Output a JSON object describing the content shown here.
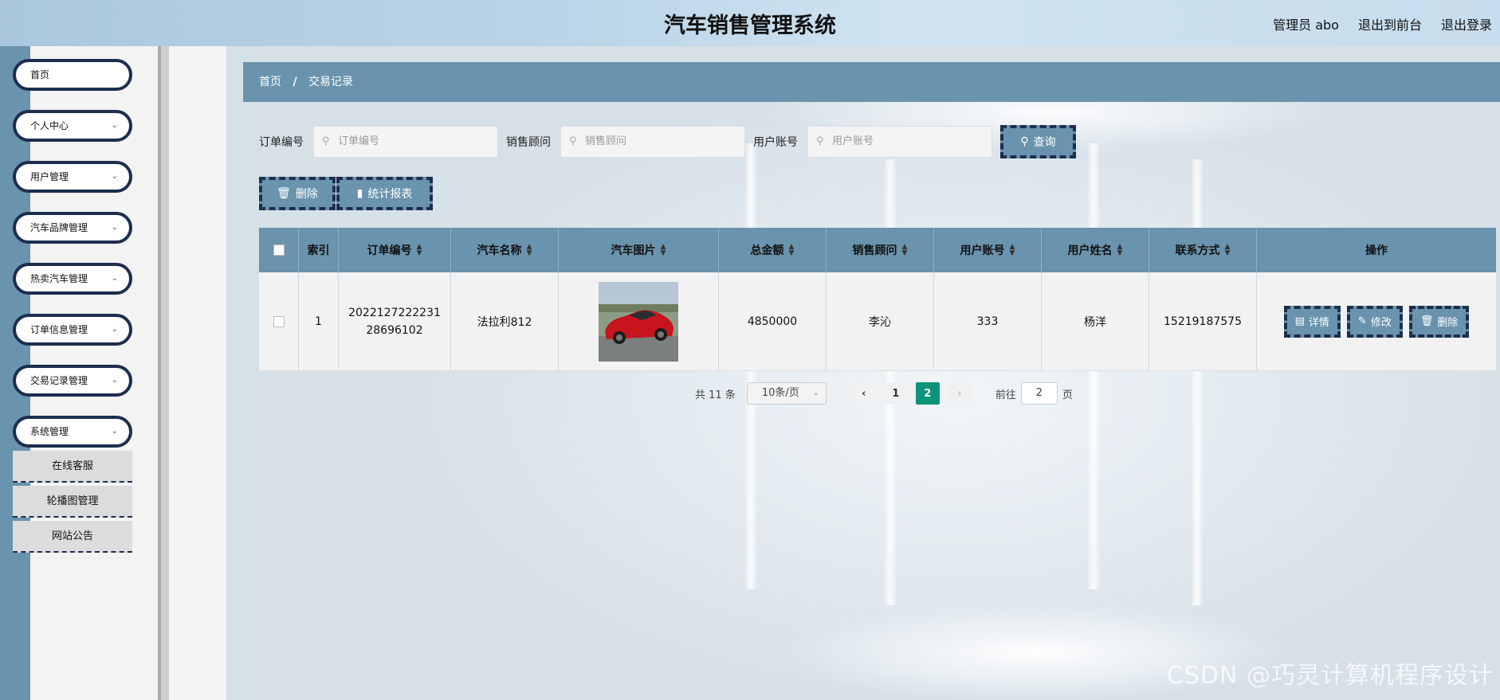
{
  "header": {
    "title": "汽车销售管理系统",
    "admin": "管理员 abo",
    "to_front": "退出到前台",
    "logout": "退出登录"
  },
  "sidebar": {
    "items": [
      {
        "label": "首页",
        "expandable": false
      },
      {
        "label": "个人中心",
        "expandable": true
      },
      {
        "label": "用户管理",
        "expandable": true
      },
      {
        "label": "汽车品牌管理",
        "expandable": true
      },
      {
        "label": "热卖汽车管理",
        "expandable": true
      },
      {
        "label": "订单信息管理",
        "expandable": true
      },
      {
        "label": "交易记录管理",
        "expandable": true
      },
      {
        "label": "系统管理",
        "expandable": true
      }
    ],
    "subitems": [
      "在线客服",
      "轮播图管理",
      "网站公告"
    ]
  },
  "breadcrumb": {
    "home": "首页",
    "sep": "/",
    "current": "交易记录"
  },
  "search": {
    "order_label": "订单编号",
    "order_placeholder": "订单编号",
    "advisor_label": "销售顾问",
    "advisor_placeholder": "销售顾问",
    "account_label": "用户账号",
    "account_placeholder": "用户账号",
    "query_btn": "查询"
  },
  "actions": {
    "delete": "删除",
    "report": "统计报表"
  },
  "table": {
    "headers": {
      "index": "索引",
      "order_no": "订单编号",
      "car_name": "汽车名称",
      "car_image": "汽车图片",
      "total": "总金额",
      "advisor": "销售顾问",
      "account": "用户账号",
      "user_name": "用户姓名",
      "contact": "联系方式",
      "ops": "操作"
    },
    "rows": [
      {
        "index": "1",
        "order_no": "202212722223128696102",
        "car_name": "法拉利812",
        "total": "4850000",
        "advisor": "李沁",
        "account": "333",
        "user_name": "杨洋",
        "contact": "15219187575"
      }
    ],
    "row_ops": {
      "detail": "详情",
      "edit": "修改",
      "delete": "删除"
    }
  },
  "pagination": {
    "total": "共 11 条",
    "page_size": "10条/页",
    "pages": [
      "1",
      "2"
    ],
    "current_page": "2",
    "goto_label": "前往",
    "goto_value": "2",
    "page_suffix": "页"
  },
  "watermark": "CSDN @巧灵计算机程序设计",
  "colors": {
    "accent": "#6a93ad",
    "border": "#1d2e4e",
    "active_page": "#0d9478"
  }
}
